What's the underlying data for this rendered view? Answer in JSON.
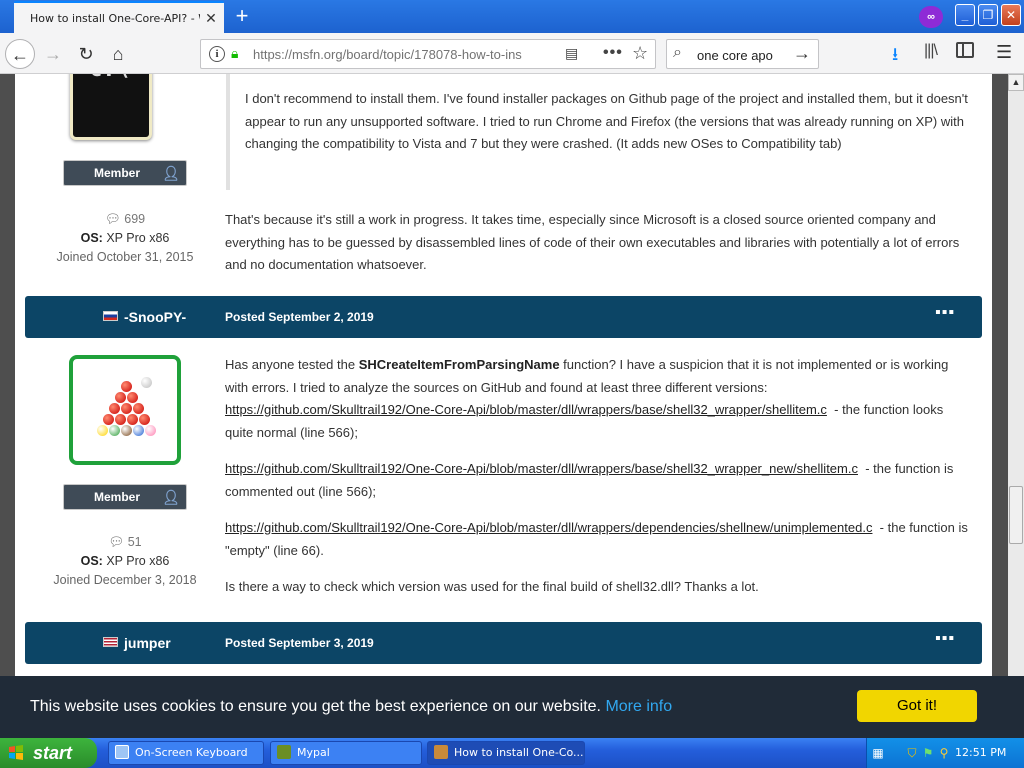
{
  "browser": {
    "tab_title": "How to install One-Core-API? - Wi",
    "tab_close": "✕",
    "new_tab": "+",
    "private_badge": "∞",
    "window_min": "_",
    "window_max": "❐",
    "window_close": "✕",
    "url": "https://msfn.org/board/topic/178078-how-to-ins",
    "search_value": "one core apo"
  },
  "prev_post": {
    "badge": "Member",
    "post_count": "699",
    "os_label": "OS:",
    "os_value": "XP Pro x86",
    "joined": "Joined October 31, 2015",
    "quote": "I don't recommend to install them. I've found installer packages on Github page of the project and installed them, but it doesn't appear to run any unsupported software. I tried to run Chrome and Firefox (the versions that was already running on XP) with changing the compatibility to Vista and 7 but they were crashed. (It adds new OSes to Compatibility tab)",
    "reply": "That's because it's still a work in progress. It takes time, especially since Microsoft is a closed source oriented company and everything has to be guessed by disassembled lines of code of their own executables and libraries with potentially a lot of errors and no documentation whatsoever."
  },
  "post_snoopy": {
    "author": "-SnooPY-",
    "posted": "Posted September 2, 2019",
    "menu": "▪▪▪",
    "badge": "Member",
    "post_count": "51",
    "os_label": "OS:",
    "os_value": "XP Pro x86",
    "joined": "Joined December 3, 2018",
    "p1_before": "Has anyone tested the ",
    "p1_bold": "SHCreateItemFromParsingName",
    "p1_after": " function? I have a suspicion that it is not implemented or is working with errors. I tried to analyze the sources on GitHub and found at least three different versions:",
    "link1": "https://github.com/Skulltrail192/One-Core-Api/blob/master/dll/wrappers/base/shell32_wrapper/shellitem.c",
    "link1_note": "  - the function looks quite normal (line 566);",
    "link2": "https://github.com/Skulltrail192/One-Core-Api/blob/master/dll/wrappers/base/shell32_wrapper_new/shellitem.c",
    "link2_note": "  - the function is commented out (line 566);",
    "link3": "https://github.com/Skulltrail192/One-Core-Api/blob/master/dll/wrappers/dependencies/shellnew/unimplemented.c",
    "link3_note": "  - the function is \"empty\" (line 66).",
    "closing": "Is there a way to check which version was used for the final build of shell32.dll? Thanks a lot."
  },
  "post_jumper": {
    "author": "jumper",
    "posted": "Posted September 3, 2019",
    "menu": "▪▪▪"
  },
  "cookie": {
    "text": "This website uses cookies to ensure you get the best experience on our website.",
    "more": "More info",
    "button": "Got it!"
  },
  "taskbar": {
    "start": "start",
    "tasks": [
      "On-Screen Keyboard",
      "Mypal",
      "How to install One-Co..."
    ],
    "clock": "12:51 PM"
  },
  "colors": {
    "post_header": "#0c4566",
    "accent_link": "#31a8f0",
    "cookie_button": "#f1d600",
    "avatar_border": "#1fa13a"
  }
}
